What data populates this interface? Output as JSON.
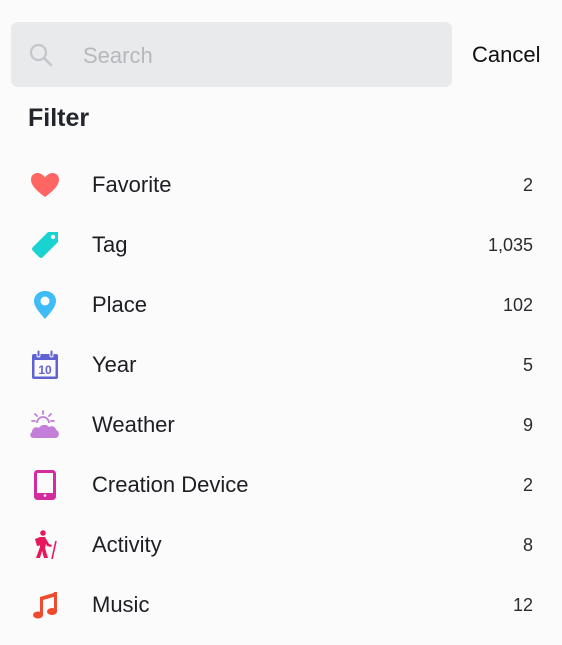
{
  "search": {
    "placeholder": "Search",
    "value": "",
    "cancel_label": "Cancel"
  },
  "filter": {
    "heading": "Filter",
    "items": [
      {
        "label": "Favorite",
        "count": "2",
        "icon": "heart-icon",
        "color": "#ff6563"
      },
      {
        "label": "Tag",
        "count": "1,035",
        "icon": "tag-icon",
        "color": "#1ad3d0"
      },
      {
        "label": "Place",
        "count": "102",
        "icon": "map-pin-icon",
        "color": "#3fbcf8"
      },
      {
        "label": "Year",
        "count": "5",
        "icon": "calendar-icon",
        "color": "#5f62d0"
      },
      {
        "label": "Weather",
        "count": "9",
        "icon": "weather-icon",
        "color": "#c27ed9"
      },
      {
        "label": "Creation Device",
        "count": "2",
        "icon": "tablet-icon",
        "color": "#d22c9e"
      },
      {
        "label": "Activity",
        "count": "8",
        "icon": "hiking-icon",
        "color": "#e8195a"
      },
      {
        "label": "Music",
        "count": "12",
        "icon": "music-note-icon",
        "color": "#ee4b2e"
      }
    ]
  }
}
